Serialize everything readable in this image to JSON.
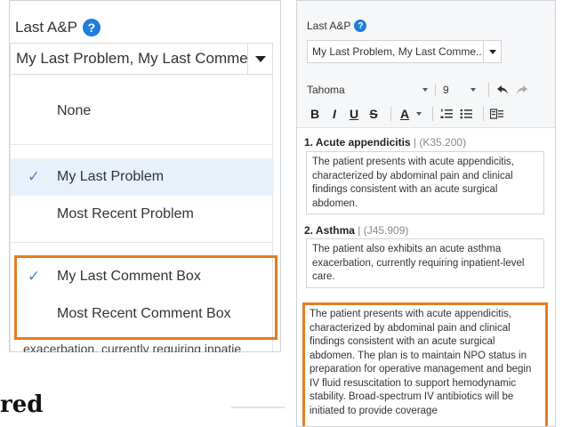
{
  "left": {
    "section_label": "Last A&P",
    "help_icon": "?",
    "select_value": "My Last Problem, My Last Comme...",
    "options": [
      {
        "label": "None",
        "checked": false
      },
      {
        "label": "My Last Problem",
        "checked": true
      },
      {
        "label": "Most Recent Problem",
        "checked": false
      },
      {
        "label": "My Last Comment Box",
        "checked": true
      },
      {
        "label": "Most Recent Comment Box",
        "checked": false
      }
    ],
    "peek_text": "exacerbation, currently requiring inpatie",
    "bottom_heading": "red"
  },
  "right": {
    "section_label": "Last A&P",
    "help_icon": "?",
    "select_value": "My Last Problem, My Last Comme...",
    "toolbar": {
      "font": "Tahoma",
      "size": "9",
      "bold": "B",
      "italic": "I",
      "underline": "U",
      "strike": "S",
      "font_color": "A",
      "undo_icon": "undo-icon",
      "redo_icon": "redo-icon",
      "ordered_list_icon": "ordered-list-icon",
      "bullet_list_icon": "bullet-list-icon",
      "insert_icon": "insert-template-icon"
    },
    "problems": [
      {
        "title": "1. Acute appendicitis",
        "code": " | (K35.200)",
        "comment": "The patient presents with acute appendicitis, characterized by abdominal pain and clinical findings consistent with an acute surgical abdomen."
      },
      {
        "title": "2. Asthma",
        "code": " | (J45.909)",
        "comment": "The patient also exhibits an acute asthma exacerbation, currently requiring inpatient-level care."
      }
    ],
    "comment_box": "The patient presents with acute appendicitis, characterized by abdominal pain and clinical findings consistent with an acute surgical abdomen. The plan is to maintain NPO status in preparation for operative management and begin IV fluid resuscitation to support hemodynamic stability. Broad-spectrum IV antibiotics will be initiated to provide coverage"
  },
  "colors": {
    "accent": "#1e7fd8",
    "highlight_border": "#e57c21",
    "selected_bg": "#e8f1fa",
    "check": "#4a86c5"
  }
}
